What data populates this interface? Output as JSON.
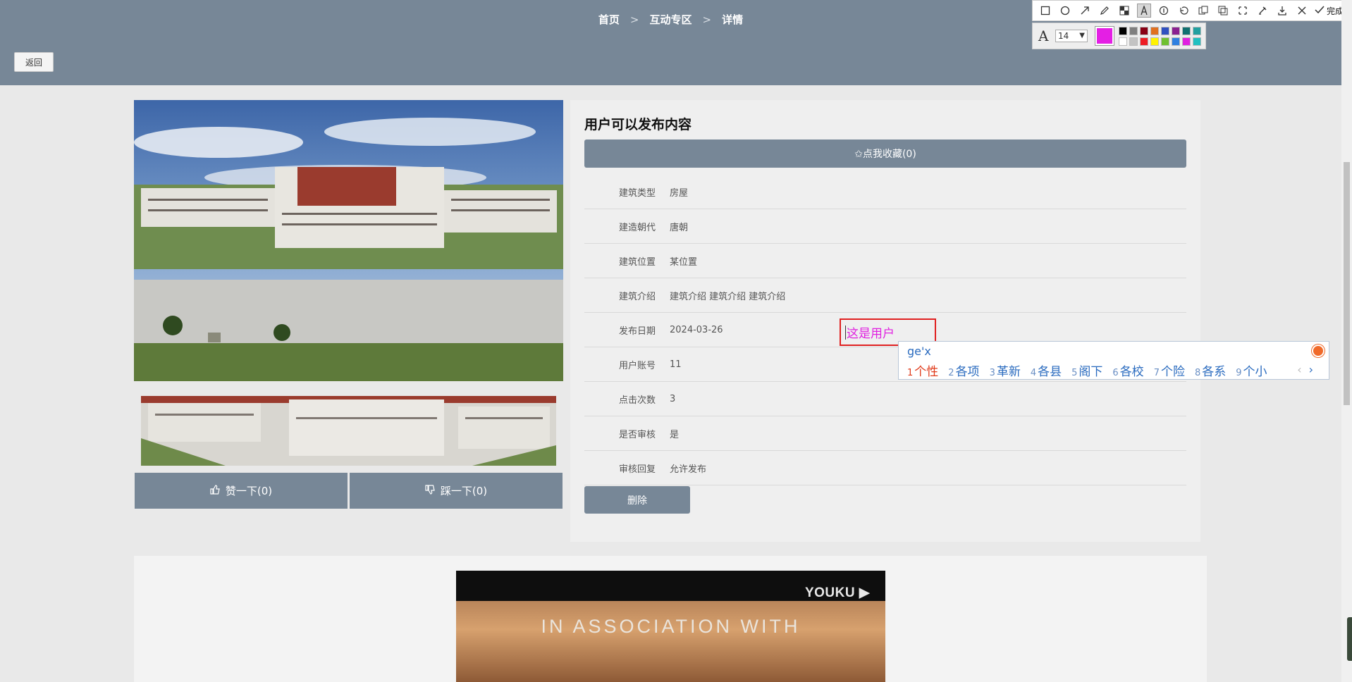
{
  "breadcrumb": {
    "home": "首页",
    "section": "互动专区",
    "current": "详情",
    "separator": ">"
  },
  "back_label": "返回",
  "detail": {
    "title": "用户可以发布内容",
    "collect_label": "✩点我收藏(0)",
    "fields": [
      {
        "label": "建筑类型",
        "value": "房屋"
      },
      {
        "label": "建造朝代",
        "value": "唐朝"
      },
      {
        "label": "建筑位置",
        "value": "某位置"
      },
      {
        "label": "建筑介绍",
        "value": "建筑介绍 建筑介绍 建筑介绍"
      },
      {
        "label": "发布日期",
        "value": "2024-03-26"
      },
      {
        "label": "用户账号",
        "value": "11"
      },
      {
        "label": "点击次数",
        "value": "3"
      },
      {
        "label": "是否审核",
        "value": "是"
      },
      {
        "label": "审核回复",
        "value": "允许发布"
      }
    ],
    "delete_label": "删除"
  },
  "votes": {
    "like_label": "赞一下(0)",
    "dislike_label": "踩一下(0)"
  },
  "annotation": {
    "text": "这是用户"
  },
  "ime": {
    "pinyin": "ge'x",
    "candidates": [
      {
        "num": "1",
        "text": "个性"
      },
      {
        "num": "2",
        "text": "各项"
      },
      {
        "num": "3",
        "text": "革新"
      },
      {
        "num": "4",
        "text": "各县"
      },
      {
        "num": "5",
        "text": "阁下"
      },
      {
        "num": "6",
        "text": "各校"
      },
      {
        "num": "7",
        "text": "个险"
      },
      {
        "num": "8",
        "text": "各系"
      },
      {
        "num": "9",
        "text": "个小"
      }
    ],
    "prev": "‹",
    "next": "›"
  },
  "toolbar": {
    "tools": [
      "rectangle-icon",
      "ellipse-icon",
      "arrow-icon",
      "pencil-icon",
      "mosaic-icon",
      "text-icon",
      "serial-number-icon",
      "undo-icon",
      "redo-icon",
      "copy-icon",
      "pin-icon",
      "eraser-icon",
      "download-icon",
      "close-icon",
      "done-icon"
    ],
    "done_label": "完成",
    "font_size": "14",
    "current_color": "#e41fe4",
    "palette": [
      "#000000",
      "#7f7f7f",
      "#880015",
      "#e07020",
      "#3050c0",
      "#8a2090",
      "#107070",
      "#22a0a0",
      "#ffffff",
      "#c3c3c3",
      "#ed1c24",
      "#fff200",
      "#70c030",
      "#3080e0",
      "#e020e0",
      "#20c0c0"
    ]
  },
  "video": {
    "brand": "YOUKU ▶",
    "caption": "IN ASSOCIATION WITH"
  }
}
